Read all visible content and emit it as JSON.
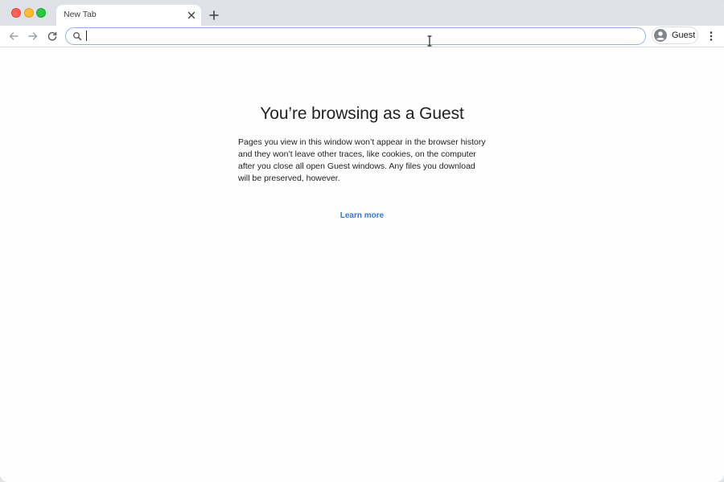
{
  "browser": {
    "tab": {
      "title": "New Tab"
    },
    "omnibox": {
      "value": "",
      "placeholder": ""
    },
    "profile": {
      "label": "Guest"
    },
    "icons": {
      "close_tab": "close-icon",
      "new_tab": "plus-icon",
      "back": "arrow-left-icon",
      "forward": "arrow-right-icon",
      "reload": "reload-icon",
      "search": "search-icon",
      "avatar": "person-avatar-icon",
      "menu": "vertical-dots-icon"
    },
    "colors": {
      "tab_strip": "#dee1e6",
      "omnibox_focus": "#8ab4f8",
      "link": "#3b77cf",
      "traffic_close": "#fe5f57",
      "traffic_min": "#febc2e",
      "traffic_max": "#28c840"
    }
  },
  "page": {
    "title": "You’re browsing as a Guest",
    "body": "Pages you view in this window won’t appear in the browser history and they won’t leave other traces, like cookies, on the computer after you close all open Guest windows. Any files you download will be preserved, however.",
    "learn_more": "Learn more"
  }
}
